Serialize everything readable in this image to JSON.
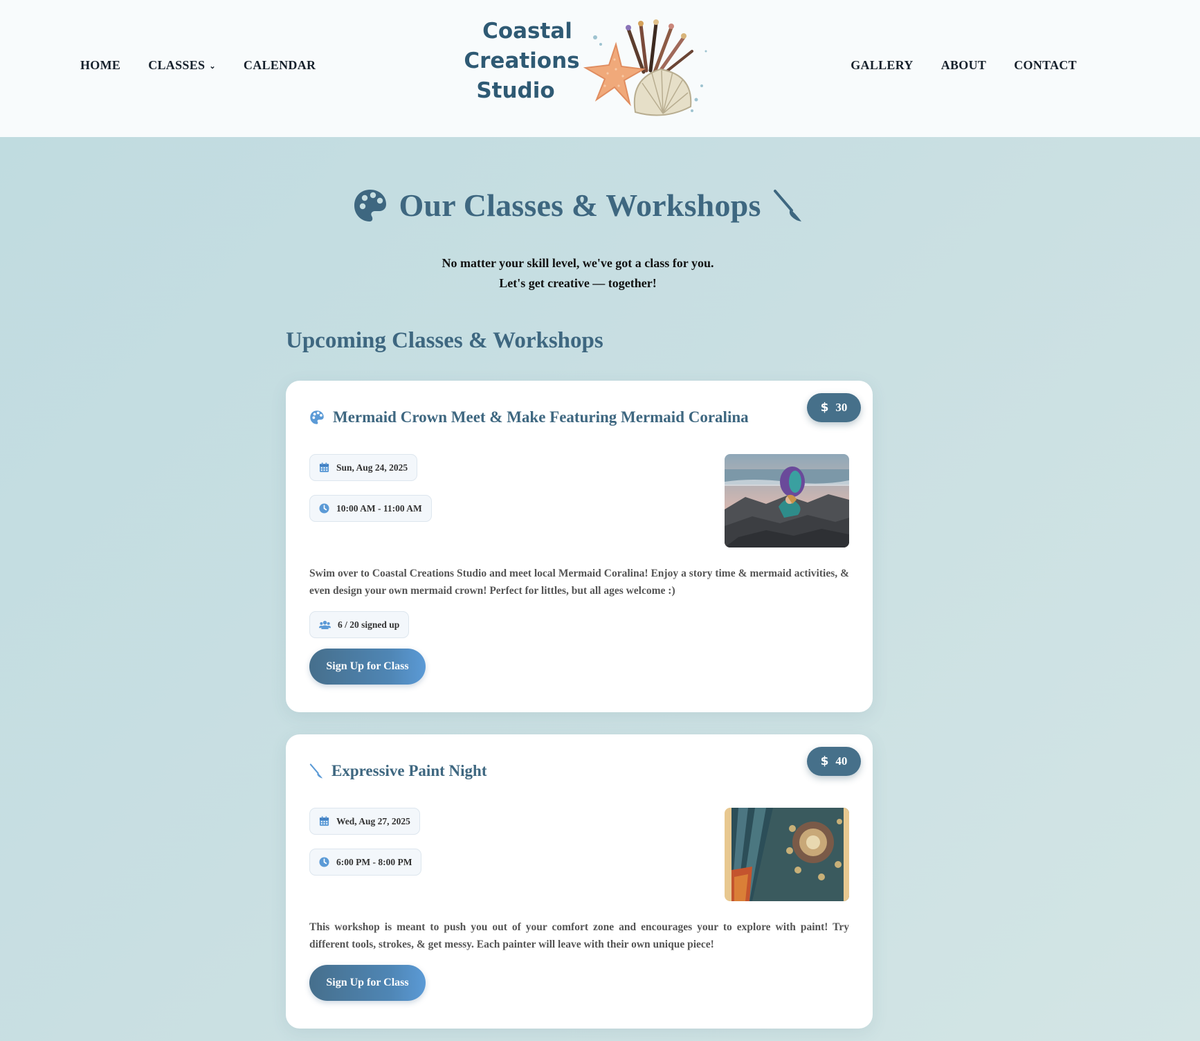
{
  "nav": {
    "left": [
      {
        "label": "HOME"
      },
      {
        "label": "CLASSES",
        "has_dropdown": true
      },
      {
        "label": "CALENDAR"
      }
    ],
    "right": [
      {
        "label": "GALLERY"
      },
      {
        "label": "ABOUT"
      },
      {
        "label": "CONTACT"
      }
    ]
  },
  "logo": {
    "line1": "Coastal",
    "line2": "Creations",
    "line3": "Studio"
  },
  "hero": {
    "title": "Our Classes & Workshops",
    "subtitle_line1": "No matter your skill level, we've got a class for you.",
    "subtitle_line2": "Let's get creative — together!"
  },
  "section_title": "Upcoming Classes & Workshops",
  "classes": [
    {
      "title": "Mermaid Crown Meet & Make Featuring Mermaid Coralina",
      "price": "30",
      "date": "Sun, Aug 24, 2025",
      "time": "10:00 AM - 11:00 AM",
      "description": "Swim over to Coastal Creations Studio and meet local Mermaid Coralina! Enjoy a story time & mermaid activities, & even design your own mermaid crown! Perfect for littles, but all ages welcome :)",
      "capacity": "6 / 20 signed up",
      "button": "Sign Up for Class",
      "icon": "palette-icon"
    },
    {
      "title": "Expressive Paint Night",
      "price": "40",
      "date": "Wed, Aug 27, 2025",
      "time": "6:00 PM - 8:00 PM",
      "description": "This workshop is meant to push you out of your comfort zone and encourages your to explore with paint! Try different tools, strokes, & get messy. Each painter will leave with their own unique piece!",
      "button": "Sign Up for Class",
      "icon": "paintbrush-icon"
    }
  ],
  "colors": {
    "accent": "#3e6780",
    "price_badge": "#46708a",
    "icon_blue": "#5b9ad6",
    "background": "#c6dee1",
    "header_bg": "#f8fbfc"
  }
}
